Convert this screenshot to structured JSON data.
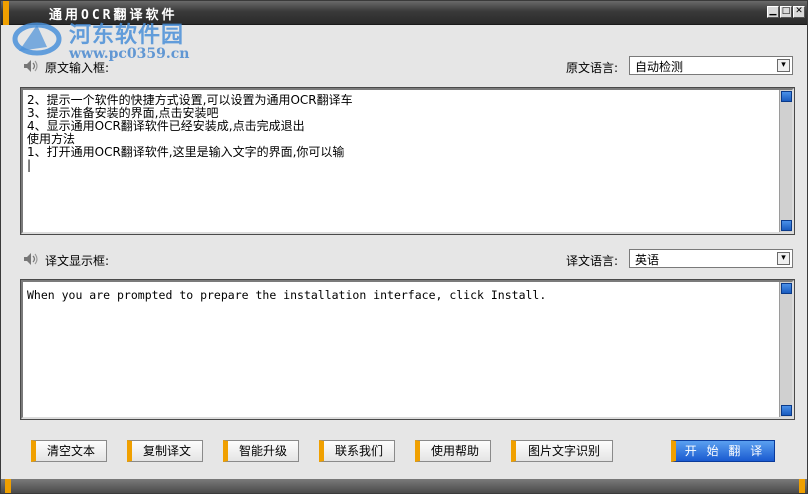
{
  "window": {
    "title": "通用OCR翻译软件",
    "controls": {
      "minimize": "▁",
      "maximize": "□",
      "close": "✕"
    }
  },
  "watermark": {
    "name": "河东软件园",
    "url": "www.pc0359.cn"
  },
  "source": {
    "label": "原文输入框:",
    "language_label": "原文语言:",
    "language_value": "自动检测",
    "text": "2、提示一个软件的快捷方式设置,可以设置为通用OCR翻译车\n3、提示准备安装的界面,点击安装吧\n4、显示通用OCR翻译软件已经安装成,点击完成退出\n使用方法\n1、打开通用OCR翻译软件,这里是输入文字的界面,你可以输\n|"
  },
  "target": {
    "label": "译文显示框:",
    "language_label": "译文语言:",
    "language_value": "英语",
    "text": "When you are prompted to prepare the installation interface, click Install."
  },
  "buttons": {
    "clear": "清空文本",
    "copy": "复制译文",
    "upgrade": "智能升级",
    "contact": "联系我们",
    "help": "使用帮助",
    "image_ocr": "图片文字识别",
    "translate": "开 始 翻 译"
  },
  "icons": {
    "speaker": "speaker-icon",
    "dropdown": "dropdown-arrow-icon",
    "logo": "logo-icon"
  }
}
